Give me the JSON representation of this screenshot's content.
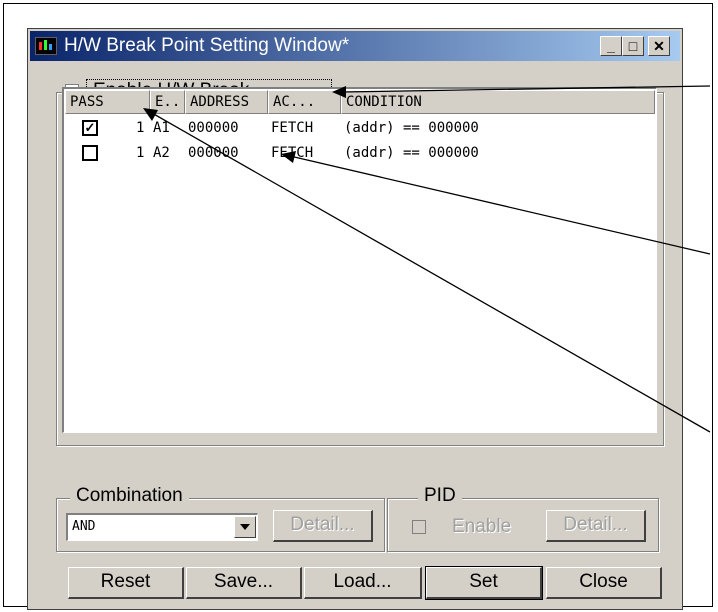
{
  "window": {
    "title": "H/W Break Point Setting Window*",
    "minimize_glyph": "_",
    "maximize_glyph": "□",
    "close_glyph": "✕"
  },
  "enable_break": {
    "label": "Enable H/W Break",
    "checked": true
  },
  "table": {
    "columns": [
      "PASS",
      "E..",
      "ADDRESS",
      "AC...",
      "CONDITION"
    ],
    "rows": [
      {
        "checked": true,
        "pass": "1",
        "event": "A1",
        "address": "000000",
        "access": "FETCH",
        "condition": "(addr) == 000000"
      },
      {
        "checked": false,
        "pass": "1",
        "event": "A2",
        "address": "000000",
        "access": "FETCH",
        "condition": "(addr) == 000000"
      }
    ]
  },
  "combination": {
    "label": "Combination",
    "value": "AND",
    "detail": "Detail..."
  },
  "pid": {
    "label": "PID",
    "enable_label": "Enable",
    "detail": "Detail..."
  },
  "buttons": {
    "reset": "Reset",
    "save": "Save...",
    "load": "Load...",
    "set": "Set",
    "close": "Close"
  },
  "check_glyph": "✓"
}
